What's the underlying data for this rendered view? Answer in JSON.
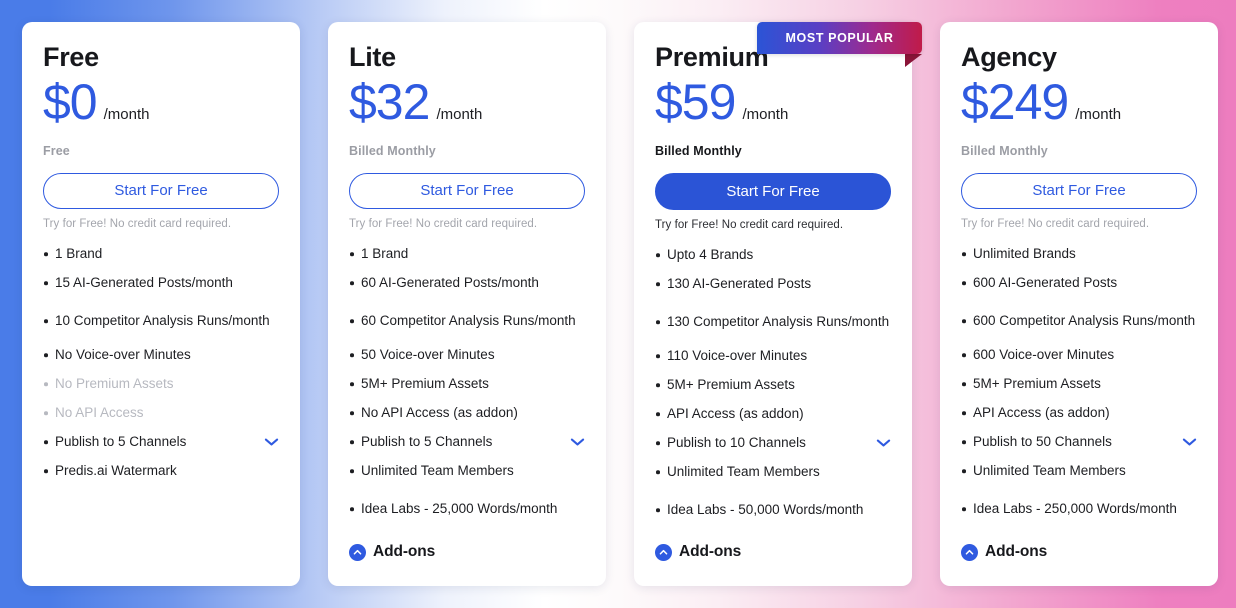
{
  "theme": {
    "accent_blue": "#2f5ae0",
    "filled_button_blue": "#2b54d6",
    "muted_text": "#b7b9c0",
    "background_left": "#4a7ce8",
    "background_right": "#ee7fc0",
    "ribbon_gradient_start": "#2b54d6",
    "ribbon_gradient_end": "#c01b49"
  },
  "ribbon": {
    "label": "MOST POPULAR"
  },
  "plans": [
    {
      "name": "Free",
      "price": "$0",
      "period": "/month",
      "billed": "Free",
      "cta_label": "Start For Free",
      "cta_note": "Try for Free! No credit card required.",
      "features": [
        {
          "text": "1 Brand",
          "muted": false,
          "chevron": false
        },
        {
          "text": "15 AI-Generated Posts/month",
          "muted": false,
          "chevron": false
        },
        {
          "text": "10 Competitor Analysis Runs/month",
          "muted": false,
          "chevron": false,
          "two_line": true
        },
        {
          "text": "No Voice-over Minutes",
          "muted": false,
          "chevron": false
        },
        {
          "text": "No Premium Assets",
          "muted": true,
          "chevron": false
        },
        {
          "text": "No API Access",
          "muted": true,
          "chevron": false
        },
        {
          "text": "Publish to 5 Channels",
          "muted": false,
          "chevron": true
        },
        {
          "text": "Predis.ai Watermark",
          "muted": false,
          "chevron": false
        }
      ],
      "addons_label": null
    },
    {
      "name": "Lite",
      "price": "$32",
      "period": "/month",
      "billed": "Billed Monthly",
      "cta_label": "Start For Free",
      "cta_note": "Try for Free! No credit card required.",
      "features": [
        {
          "text": "1 Brand",
          "muted": false,
          "chevron": false
        },
        {
          "text": "60 AI-Generated Posts/month",
          "muted": false,
          "chevron": false
        },
        {
          "text": "60 Competitor Analysis Runs/month",
          "muted": false,
          "chevron": false,
          "two_line": true
        },
        {
          "text": "50 Voice-over Minutes",
          "muted": false,
          "chevron": false
        },
        {
          "text": "5M+ Premium Assets",
          "muted": false,
          "chevron": false
        },
        {
          "text": "No API Access (as addon)",
          "muted": false,
          "chevron": false
        },
        {
          "text": "Publish to 5 Channels",
          "muted": false,
          "chevron": true
        },
        {
          "text": "Unlimited Team Members",
          "muted": false,
          "chevron": false
        },
        {
          "text": "Idea Labs - 25,000 Words/month",
          "muted": false,
          "chevron": false,
          "two_line": true
        }
      ],
      "addons_label": "Add-ons"
    },
    {
      "name": "Premium",
      "price": "$59",
      "period": "/month",
      "billed": "Billed Monthly",
      "cta_label": "Start For Free",
      "cta_note": "Try for Free! No credit card required.",
      "features": [
        {
          "text": "Upto 4 Brands",
          "muted": false,
          "chevron": false
        },
        {
          "text": "130 AI-Generated Posts",
          "muted": false,
          "chevron": false
        },
        {
          "text": "130 Competitor Analysis Runs/month",
          "muted": false,
          "chevron": false,
          "two_line": true
        },
        {
          "text": "110 Voice-over Minutes",
          "muted": false,
          "chevron": false
        },
        {
          "text": "5M+ Premium Assets",
          "muted": false,
          "chevron": false
        },
        {
          "text": "API Access (as addon)",
          "muted": false,
          "chevron": false
        },
        {
          "text": "Publish to 10 Channels",
          "muted": false,
          "chevron": true
        },
        {
          "text": "Unlimited Team Members",
          "muted": false,
          "chevron": false
        },
        {
          "text": "Idea Labs - 50,000 Words/month",
          "muted": false,
          "chevron": false,
          "two_line": true
        }
      ],
      "addons_label": "Add-ons"
    },
    {
      "name": "Agency",
      "price": "$249",
      "period": "/month",
      "billed": "Billed Monthly",
      "cta_label": "Start For Free",
      "cta_note": "Try for Free! No credit card required.",
      "features": [
        {
          "text": "Unlimited Brands",
          "muted": false,
          "chevron": false
        },
        {
          "text": "600 AI-Generated Posts",
          "muted": false,
          "chevron": false
        },
        {
          "text": "600 Competitor Analysis Runs/month",
          "muted": false,
          "chevron": false,
          "two_line": true
        },
        {
          "text": "600 Voice-over Minutes",
          "muted": false,
          "chevron": false
        },
        {
          "text": "5M+ Premium Assets",
          "muted": false,
          "chevron": false
        },
        {
          "text": "API Access (as addon)",
          "muted": false,
          "chevron": false
        },
        {
          "text": "Publish to 50 Channels",
          "muted": false,
          "chevron": true
        },
        {
          "text": "Unlimited Team Members",
          "muted": false,
          "chevron": false
        },
        {
          "text": "Idea Labs - 250,000 Words/month",
          "muted": false,
          "chevron": false,
          "two_line": true
        }
      ],
      "addons_label": "Add-ons"
    }
  ]
}
